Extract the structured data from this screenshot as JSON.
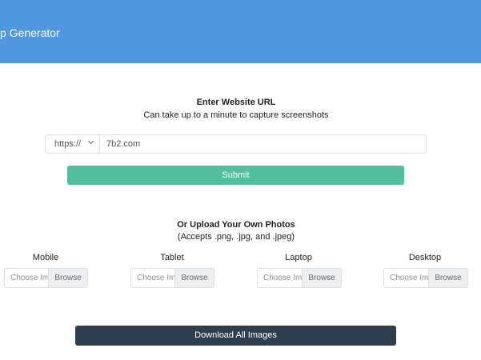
{
  "header": {
    "title": "p Generator",
    "color": "#5197df"
  },
  "url_section": {
    "heading": "Enter Website URL",
    "subheading": "Can take up to a minute to capture screenshots",
    "protocol_selected": "https://",
    "url_value": "7b2.com",
    "submit_label": "Submit",
    "submit_color": "#52bf9f"
  },
  "upload_section": {
    "heading": "Or Upload Your Own Photos",
    "subheading": "(Accepts .png, .jpg, and .jpeg)",
    "devices": [
      {
        "label": "Mobile",
        "choose_text": "Choose Im",
        "browse_label": "Browse"
      },
      {
        "label": "Tablet",
        "choose_text": "Choose Im",
        "browse_label": "Browse"
      },
      {
        "label": "Laptop",
        "choose_text": "Choose Im",
        "browse_label": "Browse"
      },
      {
        "label": "Desktop",
        "choose_text": "Choose Im",
        "browse_label": "Browse"
      }
    ]
  },
  "download": {
    "label": "Download All Images",
    "color": "#2f3e4e"
  }
}
